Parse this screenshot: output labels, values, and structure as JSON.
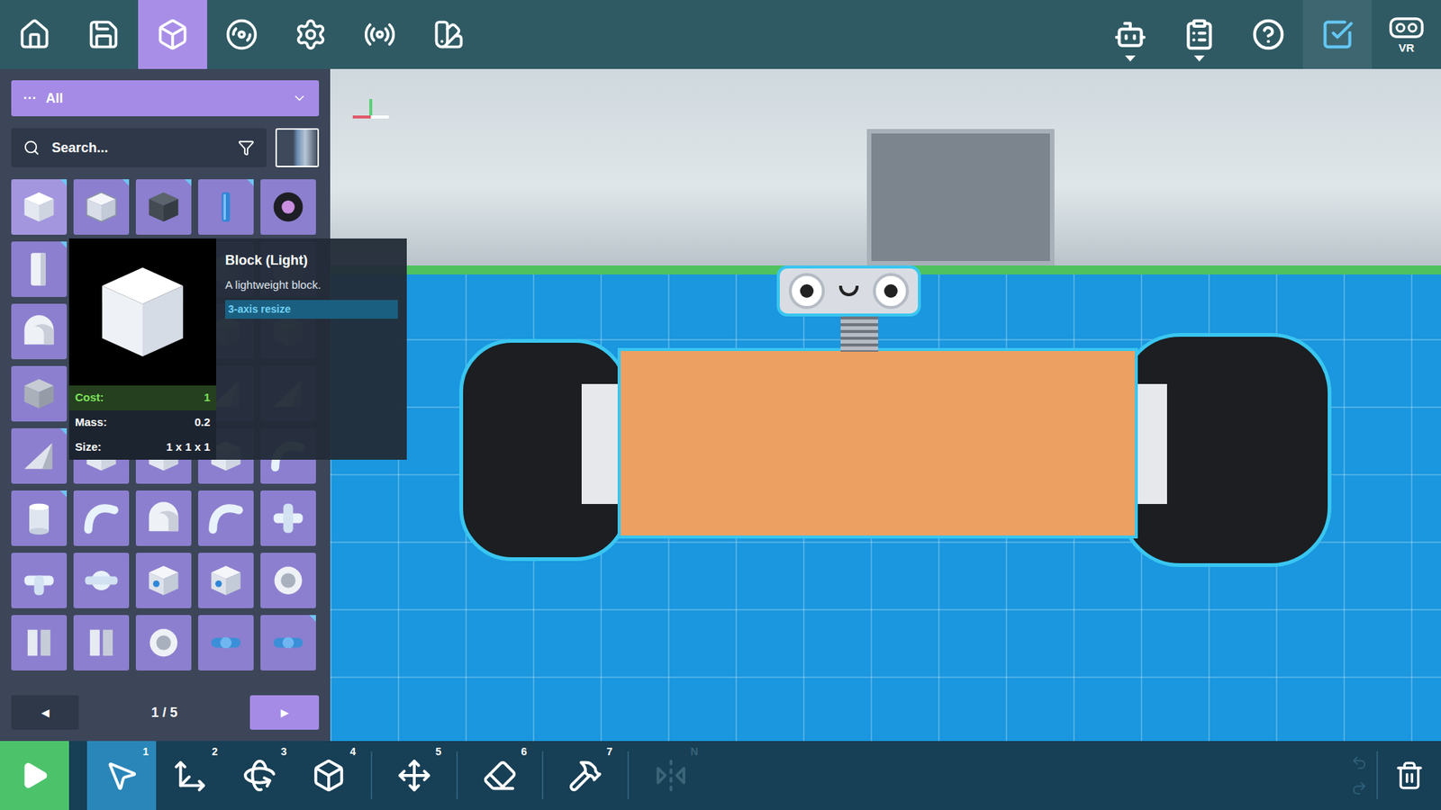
{
  "toolbar_left": [
    {
      "kind": "home",
      "selected": false
    },
    {
      "kind": "save",
      "selected": false
    },
    {
      "kind": "parts",
      "selected": true
    },
    {
      "kind": "wheels",
      "selected": false
    },
    {
      "kind": "settings",
      "selected": false
    },
    {
      "kind": "broadcast",
      "selected": false
    },
    {
      "kind": "paint",
      "selected": false
    }
  ],
  "toolbar_right": [
    {
      "kind": "robot",
      "dropdown": true,
      "selected": false,
      "label": ""
    },
    {
      "kind": "list",
      "dropdown": true,
      "selected": false,
      "label": ""
    },
    {
      "kind": "help",
      "dropdown": false,
      "selected": false,
      "label": ""
    },
    {
      "kind": "checklist",
      "dropdown": false,
      "selected": true,
      "label": ""
    },
    {
      "kind": "vr",
      "dropdown": false,
      "selected": false,
      "label": "VR"
    }
  ],
  "category": {
    "prefix": "···",
    "label": "All"
  },
  "search": {
    "placeholder": "Search..."
  },
  "parts": [
    {
      "kind": "cube-light",
      "variants": true,
      "hovered": true
    },
    {
      "kind": "cube-frame",
      "variants": true,
      "hovered": false
    },
    {
      "kind": "cube-dark",
      "variants": true,
      "hovered": false
    },
    {
      "kind": "pillar",
      "variants": true,
      "hovered": false
    },
    {
      "kind": "wheel",
      "variants": false,
      "hovered": false
    },
    {
      "kind": "panel",
      "variants": true,
      "hovered": false
    },
    {
      "kind": "wedge",
      "variants": false,
      "hovered": false
    },
    {
      "kind": "wedge",
      "variants": false,
      "hovered": false
    },
    {
      "kind": "cube-gray",
      "variants": false,
      "hovered": false
    },
    {
      "kind": "cube-gray",
      "variants": false,
      "hovered": false
    },
    {
      "kind": "arch",
      "variants": false,
      "hovered": false
    },
    {
      "kind": "wedge",
      "variants": false,
      "hovered": false
    },
    {
      "kind": "cube-gray",
      "variants": false,
      "hovered": false
    },
    {
      "kind": "cube-gray",
      "variants": false,
      "hovered": false
    },
    {
      "kind": "cube-gray",
      "variants": false,
      "hovered": false
    },
    {
      "kind": "cube-gray",
      "variants": false,
      "hovered": false
    },
    {
      "kind": "wedge",
      "variants": false,
      "hovered": false
    },
    {
      "kind": "wedge",
      "variants": false,
      "hovered": false
    },
    {
      "kind": "wedge",
      "variants": false,
      "hovered": false
    },
    {
      "kind": "wedge",
      "variants": false,
      "hovered": false
    },
    {
      "kind": "wedge",
      "variants": true,
      "hovered": false
    },
    {
      "kind": "cube-light",
      "variants": false,
      "hovered": false
    },
    {
      "kind": "cube-light",
      "variants": false,
      "hovered": false
    },
    {
      "kind": "cube-light",
      "variants": false,
      "hovered": false
    },
    {
      "kind": "bend",
      "variants": false,
      "hovered": false
    },
    {
      "kind": "cylinder",
      "variants": true,
      "hovered": false
    },
    {
      "kind": "bend",
      "variants": false,
      "hovered": false
    },
    {
      "kind": "arch",
      "variants": false,
      "hovered": false
    },
    {
      "kind": "bend",
      "variants": false,
      "hovered": false
    },
    {
      "kind": "cross",
      "variants": false,
      "hovered": false
    },
    {
      "kind": "tee",
      "variants": false,
      "hovered": false
    },
    {
      "kind": "joint",
      "variants": false,
      "hovered": false
    },
    {
      "kind": "socket",
      "variants": false,
      "hovered": false
    },
    {
      "kind": "socket",
      "variants": false,
      "hovered": false
    },
    {
      "kind": "ring",
      "variants": false,
      "hovered": false
    },
    {
      "kind": "bracket",
      "variants": false,
      "hovered": false
    },
    {
      "kind": "bracket",
      "variants": false,
      "hovered": false
    },
    {
      "kind": "ring",
      "variants": false,
      "hovered": false
    },
    {
      "kind": "connector",
      "variants": false,
      "hovered": false
    },
    {
      "kind": "connector",
      "variants": true,
      "hovered": false
    }
  ],
  "pagination": {
    "prev": "◀",
    "page": "1 / 5",
    "next": "▶"
  },
  "tooltip": {
    "title": "Block (Light)",
    "description": "A lightweight block.",
    "tag": "3-axis resize",
    "stats": [
      {
        "label": "Cost:",
        "value": "1",
        "highlight": true
      },
      {
        "label": "Mass:",
        "value": "0.2",
        "highlight": false
      },
      {
        "label": "Size:",
        "value": "1 x 1 x 1",
        "highlight": false
      }
    ]
  },
  "tools": [
    {
      "kind": "select",
      "number": "1",
      "selected": true,
      "disabled": false
    },
    {
      "kind": "move",
      "number": "2",
      "selected": false,
      "disabled": false
    },
    {
      "kind": "rotate",
      "number": "3",
      "selected": false,
      "disabled": false
    },
    {
      "kind": "scale",
      "number": "4",
      "selected": false,
      "disabled": false
    },
    {
      "kind": "place",
      "number": "5",
      "selected": false,
      "disabled": false
    },
    {
      "kind": "erase",
      "number": "6",
      "selected": false,
      "disabled": false
    },
    {
      "kind": "hammer",
      "number": "7",
      "selected": false,
      "disabled": false
    },
    {
      "kind": "mirror",
      "number": "N",
      "selected": false,
      "disabled": true
    }
  ],
  "history": {
    "undo_disabled": true,
    "redo_disabled": true
  }
}
